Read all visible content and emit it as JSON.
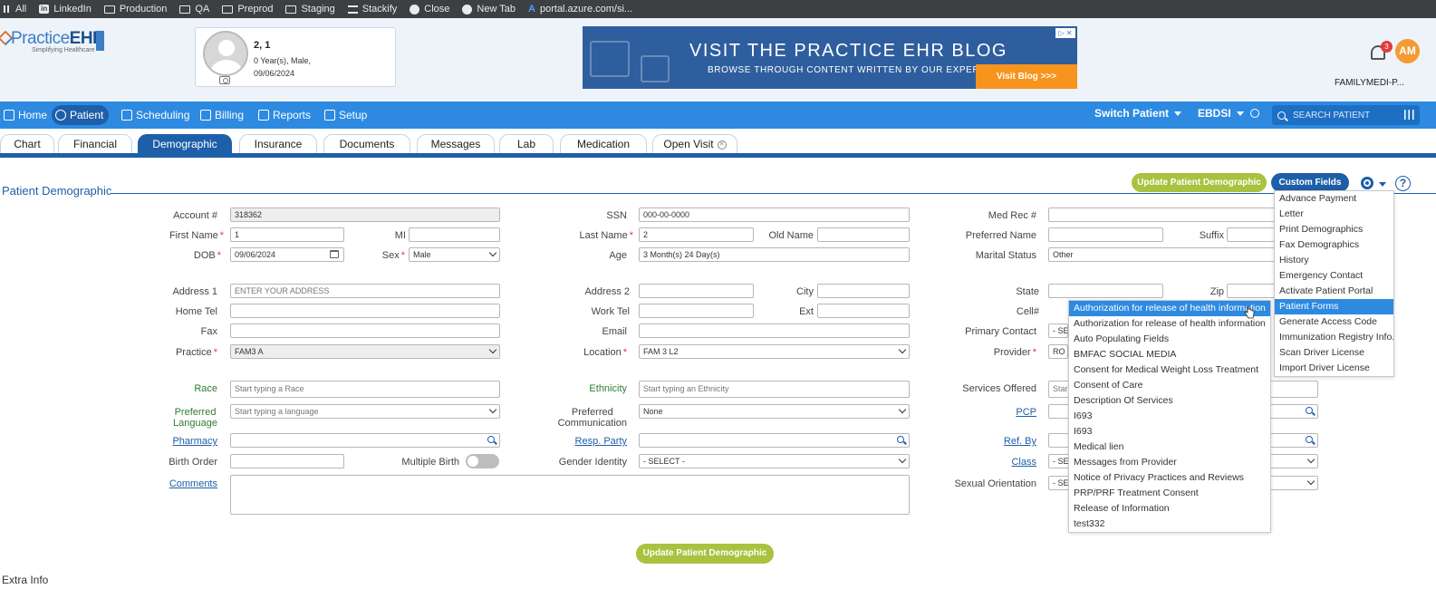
{
  "bookmarks": [
    {
      "label": "All",
      "icon": "grid-icon"
    },
    {
      "label": "LinkedIn",
      "icon": "linkedin-icon"
    },
    {
      "label": "Production",
      "icon": "folder-icon"
    },
    {
      "label": "QA",
      "icon": "folder-icon"
    },
    {
      "label": "Preprod",
      "icon": "folder-icon"
    },
    {
      "label": "Staging",
      "icon": "folder-icon"
    },
    {
      "label": "Stackify",
      "icon": "stack-icon"
    },
    {
      "label": "Close",
      "icon": "globe-icon"
    },
    {
      "label": "New Tab",
      "icon": "globe-icon"
    },
    {
      "label": "portal.azure.com/si...",
      "icon": "azure-icon"
    }
  ],
  "header": {
    "logo_main": "Practice",
    "logo_bold": "EHR",
    "logo_sub": "Simplifying Healthcare",
    "patient_name": "2, 1",
    "patient_age_sex": "0 Year(s), Male,",
    "patient_dob": "09/06/2024",
    "ad_title": "VISIT THE PRACTICE EHR BLOG",
    "ad_sub": "BROWSE THROUGH CONTENT WRITTEN BY OUR EXPERTS.",
    "ad_button": "Visit Blog >>>",
    "notification_count": "3",
    "user_initials": "AM",
    "practice_name": "FAMILYMEDI-P..."
  },
  "nav": {
    "items": [
      "Home",
      "Patient",
      "Scheduling",
      "Billing",
      "Reports",
      "Setup"
    ],
    "switch_patient": "Switch Patient",
    "ebdsi": "EBDSI",
    "search_placeholder": "SEARCH PATIENT"
  },
  "tabs": [
    "Chart",
    "Financial",
    "Demographic",
    "Insurance",
    "Documents",
    "Messages",
    "Lab",
    "Medication",
    "Open Visit"
  ],
  "page": {
    "title": "Patient Demographic",
    "update_button": "Update Patient Demographic",
    "custom_fields_button": "Custom Fields",
    "extra_info": "Extra Info"
  },
  "form": {
    "account_label": "Account #",
    "account_value": "318362",
    "ssn_label": "SSN",
    "ssn_value": "000-00-0000",
    "medrec_label": "Med Rec #",
    "first_name_label": "First Name",
    "first_name_value": "1",
    "mi_label": "MI",
    "last_name_label": "Last Name",
    "last_name_value": "2",
    "old_name_label": "Old Name",
    "preferred_name_label": "Preferred Name",
    "suffix_label": "Suffix",
    "dob_label": "DOB",
    "dob_value": "09/06/2024",
    "sex_label": "Sex",
    "sex_value": "Male",
    "age_label": "Age",
    "age_value": "3 Month(s) 24 Day(s)",
    "marital_label": "Marital Status",
    "marital_value": "Other",
    "address1_label": "Address 1",
    "address1_placeholder": "ENTER YOUR ADDRESS",
    "address2_label": "Address 2",
    "city_label": "City",
    "state_label": "State",
    "zip_label": "Zip",
    "home_tel_label": "Home Tel",
    "work_tel_label": "Work Tel",
    "ext_label": "Ext",
    "cell_label": "Cell#",
    "fax_label": "Fax",
    "email_label": "Email",
    "primary_contact_label": "Primary Contact",
    "primary_contact_value": "- SE",
    "practice_label": "Practice",
    "practice_value": "FAM3 A",
    "location_label": "Location",
    "location_value": "FAM 3 L2",
    "provider_label": "Provider",
    "provider_value": "RO",
    "race_label": "Race",
    "race_placeholder": "Start typing a Race",
    "ethnicity_label": "Ethnicity",
    "ethnicity_placeholder": "Start typing an Ethnicity",
    "services_label": "Services Offered",
    "services_placeholder": "Star",
    "pref_lang_label_1": "Preferred",
    "pref_lang_label_2": "Language",
    "pref_lang_placeholder": "Start typing a language",
    "pref_comm_label_1": "Preferred",
    "pref_comm_label_2": "Communication",
    "pref_comm_value": "None",
    "pcp_label": "PCP",
    "pharmacy_label": "Pharmacy",
    "resp_party_label": "Resp. Party",
    "ref_by_label": "Ref. By",
    "birth_order_label": "Birth Order",
    "multiple_birth_label": "Multiple Birth",
    "gender_identity_label": "Gender Identity",
    "gender_identity_value": "- SELECT -",
    "class_label": "Class",
    "class_value": "- SE",
    "comments_label": "Comments",
    "sexual_orientation_label": "Sexual Orientation",
    "sexual_orientation_value": "- SE"
  },
  "gear_menu": [
    "Advance Payment",
    "Letter",
    "Print Demographics",
    "Fax Demographics",
    "History",
    "Emergency Contact",
    "Activate Patient Portal",
    "Patient Forms",
    "Generate Access Code",
    "Immunization Registry Info.",
    "Scan Driver License",
    "Import Driver License"
  ],
  "forms_menu": [
    "Authorization for release of health information",
    "Authorization for release of health information",
    "Auto Populating Fields",
    "BMFAC SOCIAL MEDIA",
    "Consent for Medical Weight Loss Treatment",
    "Consent of Care",
    "Description Of Services",
    "I693",
    "I693",
    "Medical lien",
    "Messages from Provider",
    "Notice of Privacy Practices and Reviews",
    "PRP/PRF Treatment Consent",
    "Release of Information",
    "test332"
  ],
  "colors": {
    "nav_blue": "#2d8ae0",
    "dark_blue": "#1d5fa8",
    "green_button": "#a9c23f",
    "ad_orange": "#f7941d"
  }
}
